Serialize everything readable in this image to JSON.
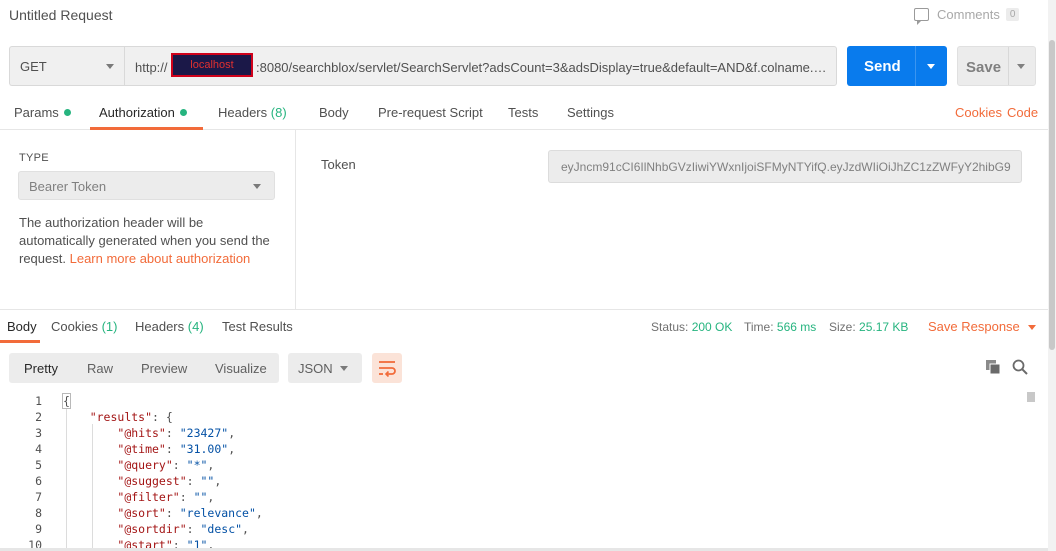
{
  "header": {
    "title": "Untitled Request",
    "comments_label": "Comments",
    "comments_count": "0"
  },
  "request": {
    "method": "GET",
    "url_prefix": "http://",
    "url_host": "localhost",
    "url_rest": ":8080/searchblox/servlet/SearchServlet?adsCount=3&adsDisplay=true&default=AND&f.colname.size ...",
    "send_label": "Send",
    "save_label": "Save"
  },
  "request_tabs": {
    "params": "Params",
    "authorization": "Authorization",
    "headers": "Headers",
    "headers_count": "(8)",
    "body": "Body",
    "prerequest": "Pre-request Script",
    "tests": "Tests",
    "settings": "Settings",
    "cookies": "Cookies",
    "code": "Code"
  },
  "auth": {
    "type_label": "TYPE",
    "type_value": "Bearer Token",
    "description": "The authorization header will be automatically generated when you send the request.",
    "learn_more": "Learn more about authorization",
    "token_label": "Token",
    "token_value": "eyJncm91cCI6IlNhbGVzIiwiYWxnIjoiSFMyNTYifQ.eyJzdWIiOiJhZC1zZWFyY2hibG9"
  },
  "response": {
    "tabs": {
      "body": "Body",
      "cookies": "Cookies",
      "cookies_count": "(1)",
      "headers": "Headers",
      "headers_count": "(4)",
      "test_results": "Test Results"
    },
    "status_label": "Status:",
    "status_value": "200 OK",
    "time_label": "Time:",
    "time_value": "566 ms",
    "size_label": "Size:",
    "size_value": "25.17 KB",
    "save_response": "Save Response"
  },
  "viewer": {
    "pretty": "Pretty",
    "raw": "Raw",
    "preview": "Preview",
    "visualize": "Visualize",
    "format": "JSON"
  },
  "code_lines": [
    {
      "n": "1",
      "indent": "",
      "key": "",
      "sep": "",
      "val": "",
      "punct": "{"
    },
    {
      "n": "2",
      "indent": "    ",
      "key": "\"results\"",
      "sep": ": ",
      "val": "",
      "punct": "{"
    },
    {
      "n": "3",
      "indent": "        ",
      "key": "\"@hits\"",
      "sep": ": ",
      "val": "\"23427\"",
      "punct": ","
    },
    {
      "n": "4",
      "indent": "        ",
      "key": "\"@time\"",
      "sep": ": ",
      "val": "\"31.00\"",
      "punct": ","
    },
    {
      "n": "5",
      "indent": "        ",
      "key": "\"@query\"",
      "sep": ": ",
      "val": "\"*\"",
      "punct": ","
    },
    {
      "n": "6",
      "indent": "        ",
      "key": "\"@suggest\"",
      "sep": ": ",
      "val": "\"\"",
      "punct": ","
    },
    {
      "n": "7",
      "indent": "        ",
      "key": "\"@filter\"",
      "sep": ": ",
      "val": "\"\"",
      "punct": ","
    },
    {
      "n": "8",
      "indent": "        ",
      "key": "\"@sort\"",
      "sep": ": ",
      "val": "\"relevance\"",
      "punct": ","
    },
    {
      "n": "9",
      "indent": "        ",
      "key": "\"@sortdir\"",
      "sep": ": ",
      "val": "\"desc\"",
      "punct": ","
    },
    {
      "n": "10",
      "indent": "        ",
      "key": "\"@start\"",
      "sep": ": ",
      "val": "\"1\"",
      "punct": ","
    }
  ]
}
